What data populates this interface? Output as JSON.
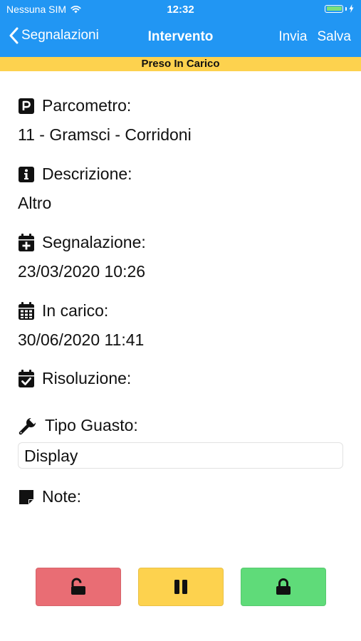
{
  "status_bar": {
    "carrier": "Nessuna SIM",
    "time": "12:32"
  },
  "nav": {
    "back_label": "Segnalazioni",
    "title": "Intervento",
    "send_label": "Invia",
    "save_label": "Salva"
  },
  "banner": {
    "text": "Preso In Carico"
  },
  "fields": {
    "parcometro": {
      "label": "Parcometro:",
      "value": "11 -  Gramsci -  Corridoni"
    },
    "descrizione": {
      "label": "Descrizione:",
      "value": "Altro"
    },
    "segnalazione": {
      "label": "Segnalazione:",
      "value": "23/03/2020 10:26"
    },
    "in_carico": {
      "label": "In carico:",
      "value": "30/06/2020 11:41"
    },
    "risoluzione": {
      "label": "Risoluzione:",
      "value": ""
    },
    "tipo_guasto": {
      "label": "Tipo Guasto:",
      "value": "Display"
    },
    "note": {
      "label": "Note:",
      "value": ""
    }
  },
  "icons": [
    "parking-icon",
    "info-icon",
    "calendar-plus-icon",
    "calendar-icon",
    "calendar-check-icon",
    "wrench-icon",
    "note-icon",
    "unlock-icon",
    "pause-icon",
    "lock-icon"
  ],
  "colors": {
    "header": "#2196f3",
    "banner": "#fdd24e",
    "unlock_button": "#e96d74",
    "pause_button": "#fdd24e",
    "lock_button": "#5fdb79"
  }
}
